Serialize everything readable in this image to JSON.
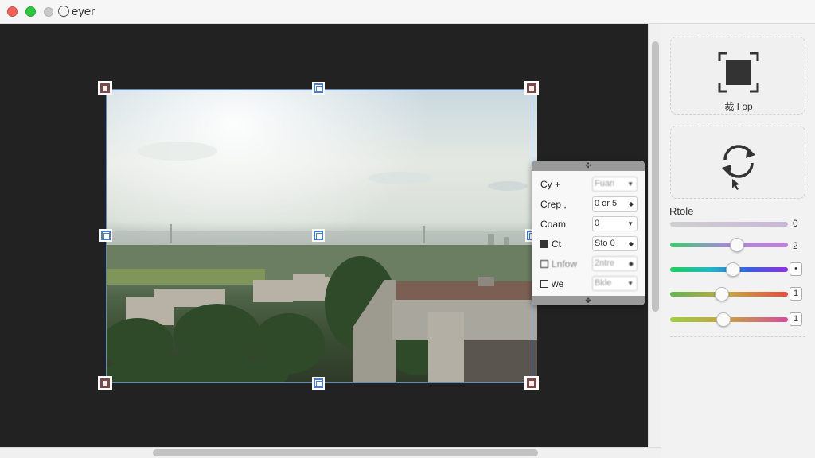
{
  "window": {
    "title": "eyer"
  },
  "crop_tool": {
    "label": "裁 I op"
  },
  "rotate_tool": {
    "label": ""
  },
  "settings_panel": {
    "rows": [
      {
        "label": "Cy +",
        "value": "Fuan"
      },
      {
        "label": "Crep ,",
        "value": "0 or 5"
      },
      {
        "label": "Coam",
        "value": "0"
      },
      {
        "label": "Ct",
        "value": "Sto 0"
      },
      {
        "label": "Lnfow",
        "value": "2ntre"
      },
      {
        "label": "we",
        "value": "Bkle"
      }
    ]
  },
  "adjust": {
    "title": "Rtole",
    "sliders": [
      {
        "value": "0",
        "level": 0.0
      },
      {
        "value": "2",
        "level": 0.57
      },
      {
        "value": "•",
        "level": 0.53
      },
      {
        "value": "1",
        "level": 0.44
      },
      {
        "value": "1",
        "level": 0.45
      }
    ]
  }
}
